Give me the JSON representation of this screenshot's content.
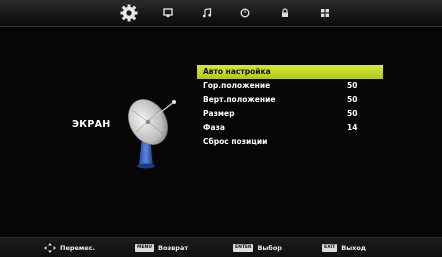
{
  "topbar": {
    "tabs": [
      {
        "icon": "gear-icon",
        "selected": true
      },
      {
        "icon": "monitor-icon",
        "selected": false
      },
      {
        "icon": "music-note-icon",
        "selected": false
      },
      {
        "icon": "clock-icon",
        "selected": false
      },
      {
        "icon": "lock-icon",
        "selected": false
      },
      {
        "icon": "grid-icon",
        "selected": false
      }
    ]
  },
  "page": {
    "title": "ЭКРАН",
    "illustration": "satellite-dish-icon"
  },
  "menu": {
    "items": [
      {
        "label": "Авто настройка",
        "value": "",
        "selected": true
      },
      {
        "label": "Гор.положение",
        "value": "50",
        "selected": false
      },
      {
        "label": "Верт.положение",
        "value": "50",
        "selected": false
      },
      {
        "label": "Размер",
        "value": "50",
        "selected": false
      },
      {
        "label": "Фаза",
        "value": "14",
        "selected": false
      },
      {
        "label": "Сброс позиции",
        "value": "",
        "selected": false
      }
    ]
  },
  "hints": {
    "move": {
      "label": "Перемес.",
      "icon": "arrows-icon"
    },
    "back": {
      "key": "MENU",
      "label": "Возврат"
    },
    "select": {
      "key": "ENTER",
      "label": "Выбор"
    },
    "exit": {
      "key": "EXIT",
      "label": "Выход"
    }
  },
  "colors": {
    "highlight": "#c8dc2a",
    "background": "#000000"
  }
}
